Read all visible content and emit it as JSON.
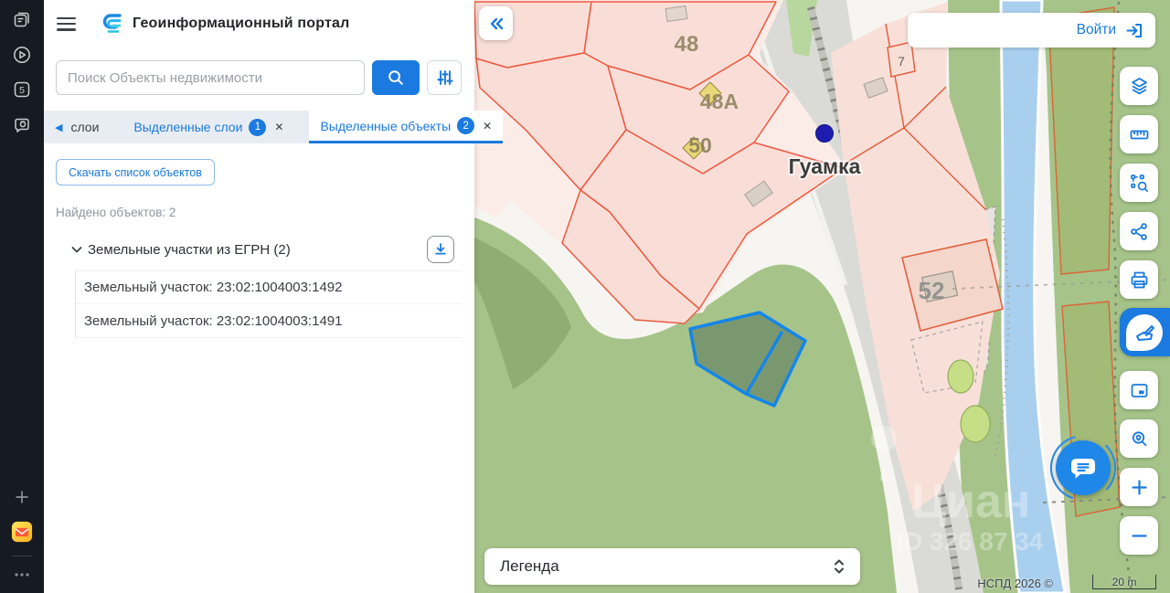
{
  "rail": {
    "tab_count": "5",
    "icons": [
      "reader-mode",
      "play",
      "tab-counter",
      "screenshot",
      "add",
      "yandex-app",
      "more"
    ]
  },
  "header": {
    "title": "Геоинформационный портал"
  },
  "search": {
    "placeholder": "Поиск Объекты недвижимости"
  },
  "tabs": {
    "layers": {
      "label": "слои"
    },
    "selected_layers": {
      "label": "Выделенные слои",
      "badge": "1",
      "close": "✕"
    },
    "selected_objects": {
      "label": "Выделенные объекты",
      "badge": "2",
      "close": "✕"
    }
  },
  "content": {
    "download_button": "Скачать список объектов",
    "found": "Найдено объектов: 2",
    "group_label": "Земельные участки из ЕГРН (2)",
    "items": [
      {
        "label": "Земельный участок: 23:02:1004003:1492"
      },
      {
        "label": "Земельный участок: 23:02:1004003:1491"
      }
    ]
  },
  "map": {
    "login": "Войти",
    "legend": "Легенда",
    "attribution": "НСПД 2026 ©",
    "scale": "20 m",
    "labels": {
      "p48": "48",
      "p48a": "48А",
      "p50": "50",
      "p52": "52",
      "p7": "7",
      "town": "Гуамка"
    },
    "watermark": {
      "line1": "Циан",
      "line2": "ID 326 87 34"
    },
    "colors": {
      "accent": "#1a7ae0",
      "parcel_outline": "#ec5a40",
      "parcel_fill": "#f9ded8",
      "selection_stroke": "#1586e8",
      "point_marker": "#1d1caf",
      "green": "#a6c48a",
      "river": "#a9cfee"
    },
    "icons": [
      "collapse-panel",
      "login",
      "layers",
      "ruler",
      "area-select",
      "share",
      "print",
      "draw",
      "minimap",
      "map-search",
      "zoom-in",
      "zoom-out",
      "chat",
      "legend-expand"
    ]
  }
}
